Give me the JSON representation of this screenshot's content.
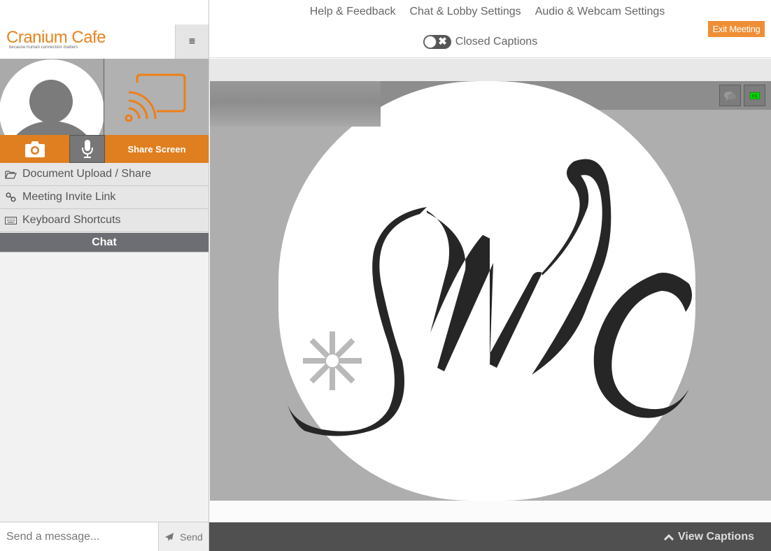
{
  "brand": {
    "name": "Cranium Cafe",
    "tagline": "because human connection matters",
    "accent_color": "#e8831f"
  },
  "sidebar": {
    "menu_icon": "hamburger-icon",
    "media": {
      "camera_icon": "camera-icon",
      "mic_icon": "microphone-icon",
      "share_icon": "cast-screen-icon",
      "share_label": "Share Screen"
    },
    "items": [
      {
        "label": "Document Upload / Share",
        "icon": "folder-open-icon"
      },
      {
        "label": "Meeting Invite Link",
        "icon": "link-icon"
      },
      {
        "label": "Keyboard Shortcuts",
        "icon": "keyboard-icon"
      }
    ],
    "chat": {
      "header": "Chat",
      "input_placeholder": "Send a message...",
      "input_value": "",
      "send_label": "Send",
      "send_icon": "paper-plane-icon"
    }
  },
  "topnav": {
    "links": [
      "Help & Feedback",
      "Chat & Lobby Settings",
      "Audio & Webcam Settings"
    ],
    "closed_captions_label": "Closed Captions",
    "closed_captions_enabled": false,
    "exit_label": "Exit Meeting"
  },
  "stage": {
    "video_buttons": [
      {
        "icon": "chat-bubbles-icon"
      },
      {
        "icon": "closed-captions-icon",
        "color": "#00e000"
      }
    ],
    "logo_text": "SWC",
    "view_captions_label": "View Captions"
  }
}
